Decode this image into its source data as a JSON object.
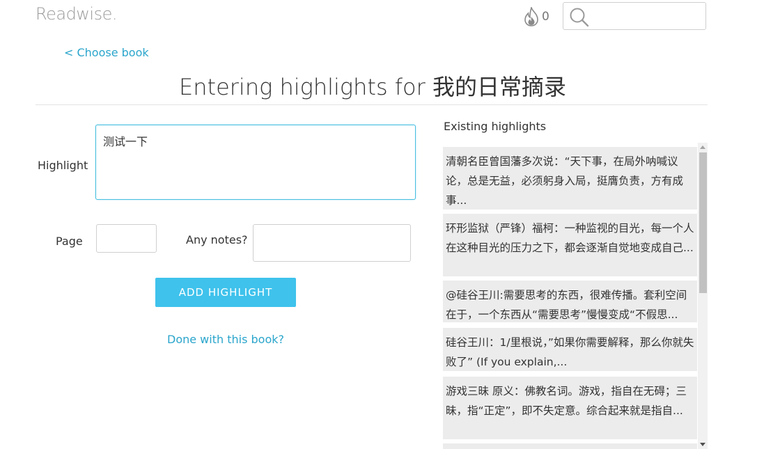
{
  "header": {
    "logo": "Readwise.",
    "streak_count": "0",
    "search_placeholder": ""
  },
  "nav": {
    "back_label": "< Choose book"
  },
  "page_title": "Entering highlights for 我的日常摘录",
  "form": {
    "highlight_label": "Highlight",
    "highlight_value": "测试一下",
    "page_label": "Page",
    "page_value": "",
    "notes_label": "Any notes?",
    "notes_value": "",
    "add_button": "ADD HIGHLIGHT",
    "done_link": "Done with this book?"
  },
  "existing": {
    "title": "Existing highlights",
    "items": [
      "清朝名臣曾国藩多次说：“天下事，在局外呐喊议论，总是无益，必须躬身入局，挺膺负责，方有成事...",
      "环形监狱（严锋）福柯：一种监视的目光，每一个人在这种目光的压力之下，都会逐渐自觉地变成自己...",
      "@硅谷王川:需要思考的东西，很难传播。套利空间在于，一个东西从“需要思考”慢慢变成“不假思...",
      "硅谷王川：1/里根说，”如果你需要解释，那么你就失败了” (If you explain,...",
      "游戏三昧 原义：佛教名词。游戏，指自在无碍；三昧，指“正定”，即不失定意。综合起来就是指自..."
    ]
  },
  "colors": {
    "accent": "#3fc2ec",
    "link": "#2aa5cc",
    "card_bg": "#ececec"
  }
}
